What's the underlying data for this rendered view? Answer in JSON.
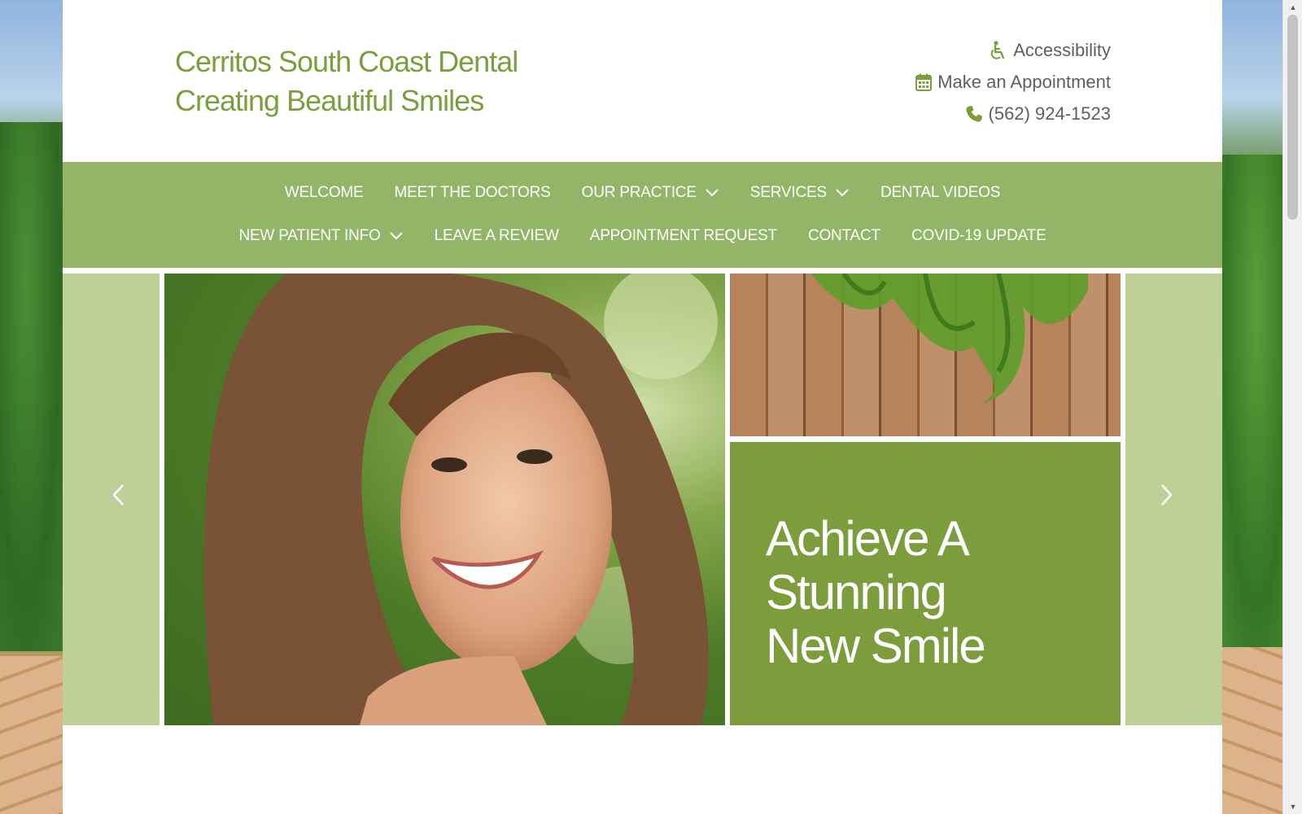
{
  "brand": {
    "line1": "Cerritos South Coast Dental",
    "line2": "Creating Beautiful Smiles",
    "color": "#7c9f3e"
  },
  "top_links": [
    {
      "label": "Accessibility",
      "icon": "wheelchair-icon"
    },
    {
      "label": "Make an Appointment",
      "icon": "calendar-icon"
    },
    {
      "label": "(562) 924-1523",
      "icon": "phone-icon"
    }
  ],
  "nav": {
    "background": "#93b567",
    "row1": [
      {
        "label": "WELCOME"
      },
      {
        "label": "MEET THE DOCTORS"
      },
      {
        "label": "OUR PRACTICE",
        "has_dropdown": true
      },
      {
        "label": "SERVICES",
        "has_dropdown": true
      },
      {
        "label": "DENTAL VIDEOS"
      }
    ],
    "row2": [
      {
        "label": "NEW PATIENT INFO",
        "has_dropdown": true
      },
      {
        "label": "LEAVE A REVIEW"
      },
      {
        "label": "APPOINTMENT REQUEST"
      },
      {
        "label": "CONTACT"
      },
      {
        "label": "COVID-19 UPDATE"
      }
    ]
  },
  "slider": {
    "headline": [
      "Achieve A",
      "Stunning",
      "New Smile"
    ],
    "accent": "#7c9d3c",
    "side_panel_color": "#bfd096",
    "prev_icon": "chevron-left-icon",
    "next_icon": "chevron-right-icon",
    "main_photo": "smiling-woman-photo",
    "secondary_photo": "wooden-fence-ivy-photo"
  }
}
